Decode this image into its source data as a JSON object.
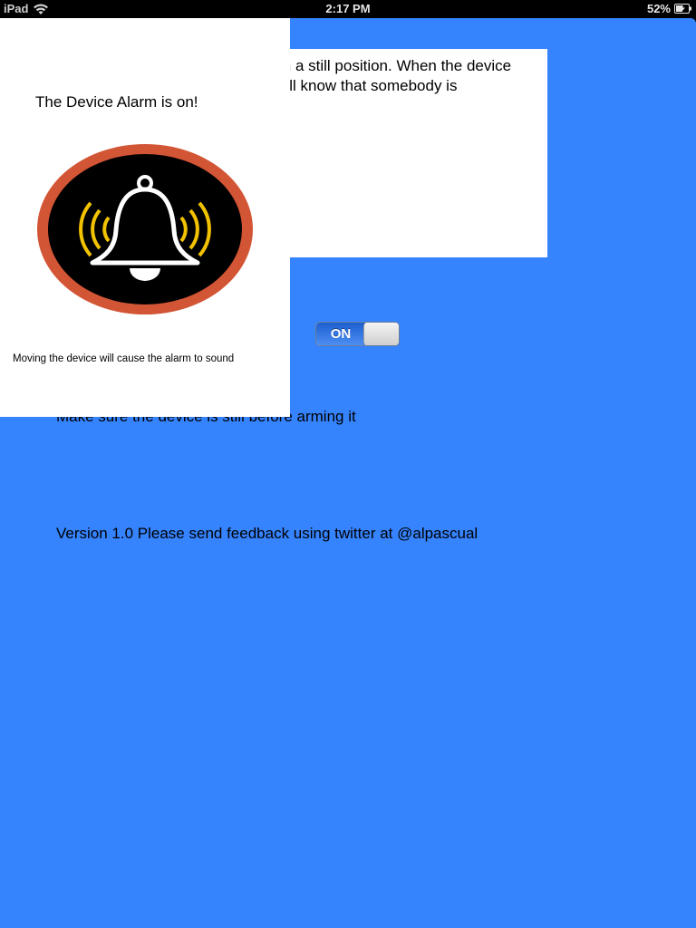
{
  "status_bar": {
    "device": "iPad",
    "time": "2:17 PM",
    "battery": "52%",
    "icons": [
      "wifi-icon",
      "battery-charging-icon"
    ]
  },
  "info_panel": {
    "text": "in a still position. When the device ... 'll know that somebody is"
  },
  "alarm_switch": {
    "label": "ON",
    "state": "on"
  },
  "notes": {
    "still": "Make sure the device is still before arming it",
    "version": "Version 1.0 Please send feedback using twitter at @alpascual"
  },
  "popover": {
    "title": "The Device Alarm is on!",
    "graphic": "alarm-bell-icon",
    "caption": "Moving the device will cause the alarm to sound"
  },
  "colors": {
    "background": "#3683fe",
    "alarm_ring": "#d25535",
    "alarm_waves": "#f2c200",
    "switch_on": "#2a6ddc"
  }
}
